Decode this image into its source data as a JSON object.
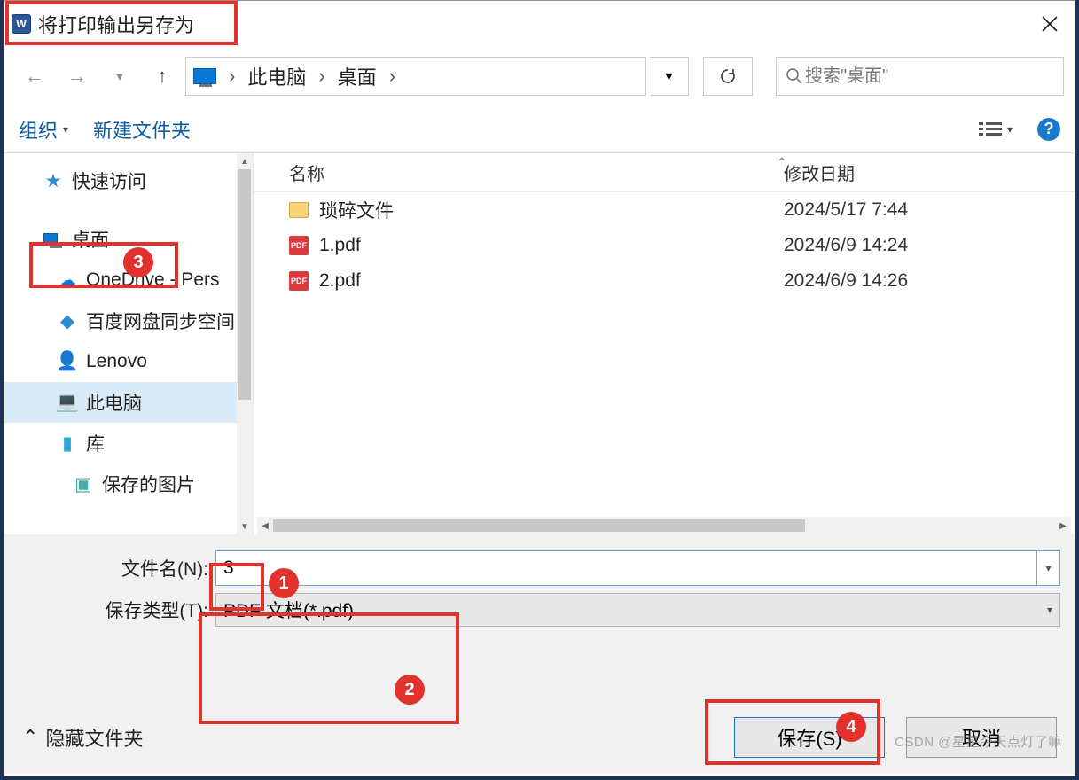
{
  "window": {
    "title": "将打印输出另存为",
    "app_icon": "W"
  },
  "breadcrumbs": {
    "root_icon": "monitor-icon",
    "items": [
      "此电脑",
      "桌面"
    ]
  },
  "search": {
    "placeholder": "搜索\"桌面\""
  },
  "toolbar": {
    "organize": "组织",
    "newfolder": "新建文件夹"
  },
  "sidebar": {
    "items": [
      {
        "icon": "star-icon",
        "label": "快速访问"
      },
      {
        "icon": "monitor-icon",
        "label": "桌面"
      },
      {
        "icon": "onedrive-icon",
        "label": "OneDrive - Pers"
      },
      {
        "icon": "baidu-icon",
        "label": "百度网盘同步空间"
      },
      {
        "icon": "user-icon",
        "label": "Lenovo"
      },
      {
        "icon": "pc-icon",
        "label": "此电脑"
      },
      {
        "icon": "library-icon",
        "label": "库"
      },
      {
        "icon": "pictures-icon",
        "label": "保存的图片"
      }
    ],
    "selected_index": 5
  },
  "filelist": {
    "columns": {
      "name": "名称",
      "date": "修改日期"
    },
    "rows": [
      {
        "type": "folder",
        "name": "琐碎文件",
        "date": "2024/5/17 7:44"
      },
      {
        "type": "pdf",
        "name": "1.pdf",
        "date": "2024/6/9 14:24"
      },
      {
        "type": "pdf",
        "name": "2.pdf",
        "date": "2024/6/9 14:26"
      }
    ]
  },
  "form": {
    "filename_label": "文件名(N):",
    "filename_value": "3",
    "filetype_label": "保存类型(T):",
    "filetype_value": "PDF 文档(*.pdf)"
  },
  "footer": {
    "hide_folders": "隐藏文件夹",
    "save": "保存(S)",
    "cancel": "取消"
  },
  "annotations": {
    "n1": "1",
    "n2": "2",
    "n3": "3",
    "n4": "4"
  },
  "icons": {
    "pdf_badge": "PDF",
    "help": "?"
  },
  "watermark": "CSDN @星星今天点灯了嘛"
}
